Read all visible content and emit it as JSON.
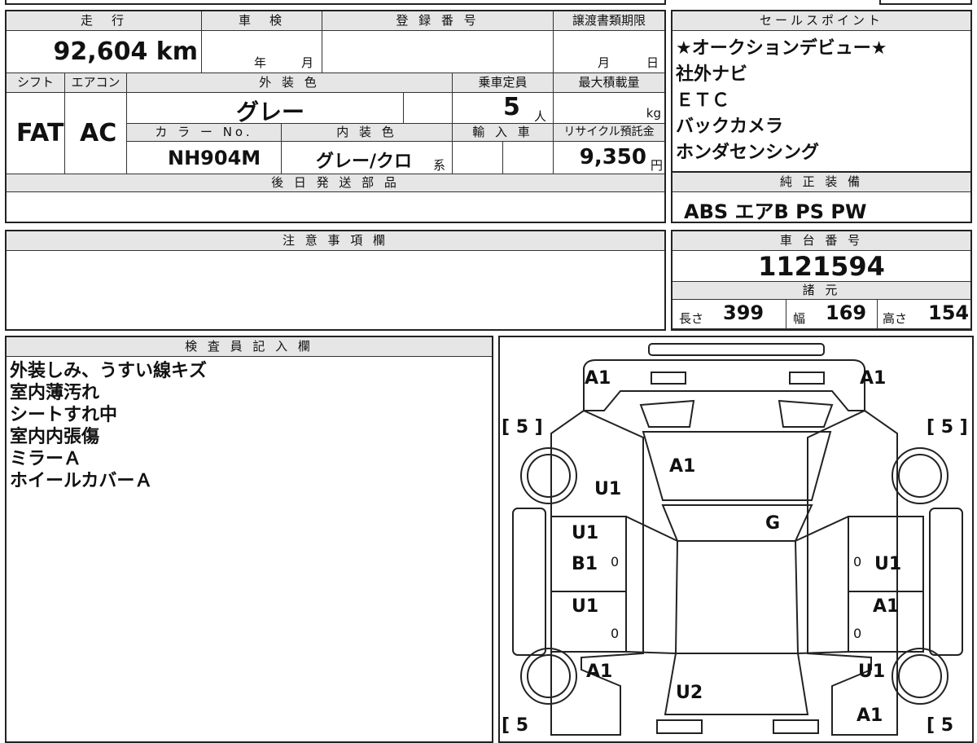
{
  "vehicle": {
    "mileage_label": "走　行",
    "mileage": "92,604",
    "mileage_unit": "km",
    "inspection_label": "車　検",
    "year_label": "年",
    "month_label": "月",
    "registration_label": "登 録 番 号",
    "registration": "",
    "transfer_label": "譲渡書類期限",
    "day_label": "日",
    "shift_label": "シフト",
    "shift": "FAT",
    "ac_label": "エアコン",
    "ac": "AC",
    "exterior_label": "外 装 色",
    "exterior_color": "グレー",
    "capacity_label": "乗車定員",
    "capacity": "5",
    "capacity_unit": "人",
    "max_load_label": "最大積載量",
    "max_load_unit": "kg",
    "color_no_label": "カ ラ ー No.",
    "color_no": "NH904M",
    "interior_label": "内 装 色",
    "interior_color": "グレー/クロ",
    "interior_suffix": "系",
    "import_label": "輸 入 車",
    "recycle_label": "リサイクル預託金",
    "recycle": "9,350",
    "recycle_unit": "円",
    "later_parts_label": "後 日 発 送 部 品"
  },
  "sales_points": {
    "label": "セールスポイント",
    "items": [
      "★オークションデビュー★",
      "社外ナビ",
      "ＥＴＣ",
      "バックカメラ",
      "ホンダセンシング"
    ]
  },
  "equipment": {
    "label": "純 正 装 備",
    "value": "ABS エアB PS PW"
  },
  "notes": {
    "label": "注 意 事 項 欄"
  },
  "chassis": {
    "label": "車 台 番 号",
    "number": "1121594",
    "spec_label": "諸 元",
    "length_label": "長さ",
    "length": "399",
    "width_label": "幅",
    "width": "169",
    "height_label": "高さ",
    "height": "154"
  },
  "inspector": {
    "label": "検 査 員 記 入 欄",
    "lines": [
      "外装しみ、うすい線キズ",
      "室内薄汚れ",
      "シートすれ中",
      "室内内張傷",
      "ミラーＡ",
      "ホイールカバーＡ"
    ]
  },
  "diagram": {
    "marks": {
      "fl_corner": "A1",
      "fr_corner": "A1",
      "hood": "A1",
      "front_left_fender": "U1",
      "windshield": "G",
      "left_front_door_1": "U1",
      "left_front_door_2": "B1",
      "right_front_door": "U1",
      "left_rear_door": "U1",
      "right_rear_door": "A1",
      "left_rear_fender": "A1",
      "right_rear_fender": "U1",
      "rear": "U2",
      "rear_right_corner": "A1",
      "tire_fl": "[ 5 ]",
      "tire_fr": "[ 5 ]",
      "tire_rl": "[ 5",
      "tire_rr": "[ 5"
    },
    "zero": "0"
  }
}
